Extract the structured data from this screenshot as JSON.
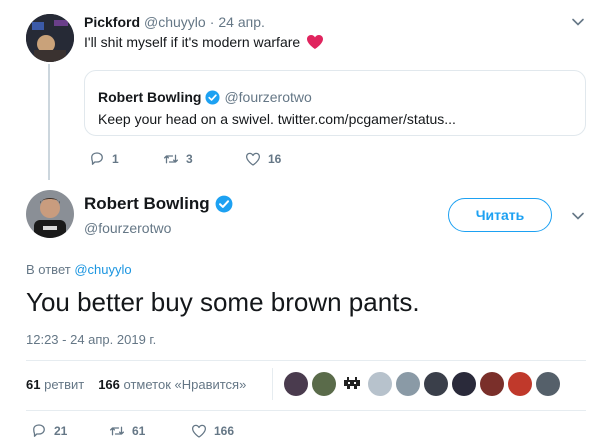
{
  "parent_tweet": {
    "name": "Pickford",
    "handle": "@chuyylo",
    "sep": "·",
    "date": "24 апр.",
    "text": "I'll shit myself if it's modern warfare",
    "emoji": "heart",
    "quote": {
      "name": "Robert Bowling",
      "handle": "@fourzerotwo",
      "text": "Keep your head on a swivel. twitter.com/pcgamer/status..."
    },
    "actions": {
      "replies": "1",
      "retweets": "3",
      "likes": "16"
    }
  },
  "main_tweet": {
    "name": "Robert Bowling",
    "handle": "@fourzerotwo",
    "follow_label": "Читать",
    "reply_prefix": "В ответ",
    "reply_to": "@chuyylo",
    "text": "You better buy some brown pants.",
    "timestamp": "12:23 - 24 апр. 2019 г.",
    "stats": {
      "retweets_count": "61",
      "retweets_label": "ретвит",
      "likes_count": "166",
      "likes_label": "отметок «Нравится»"
    },
    "actions": {
      "replies": "21",
      "retweets": "61",
      "likes": "166"
    }
  },
  "colors": {
    "verified": "#1da1f2",
    "heart_emoji": "#e0245e",
    "link": "#1b95e0",
    "muted": "#657786"
  },
  "facepile_colors": [
    "#4a3b4e",
    "#5a6b4a",
    "#222222",
    "#b7c2cc",
    "#8a9aa6",
    "#3a3f4a",
    "#2a2a3a",
    "#7a2f2a",
    "#c0392b",
    "#55606a"
  ]
}
